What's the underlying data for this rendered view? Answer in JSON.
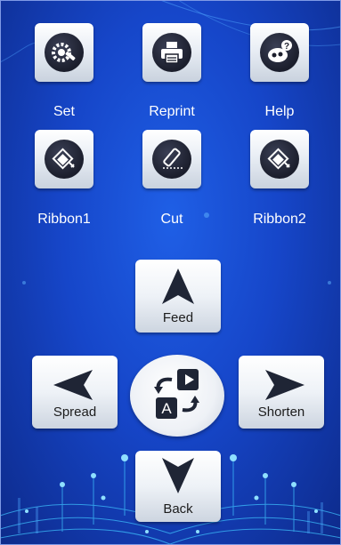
{
  "app": {
    "colors": {
      "bg": "#1646c9",
      "accent": "#3fa9ff",
      "tile": "#e9eef5",
      "icon_dark": "#1b1e2c"
    }
  },
  "grid": {
    "items": [
      {
        "label": "Set",
        "icon": "gear-wrench-icon"
      },
      {
        "label": "Reprint",
        "icon": "printer-icon"
      },
      {
        "label": "Help",
        "icon": "help-icon"
      },
      {
        "label": "Ribbon1",
        "icon": "ribbon-icon"
      },
      {
        "label": "Cut",
        "icon": "cutter-icon"
      },
      {
        "label": "Ribbon2",
        "icon": "ribbon-icon"
      }
    ]
  },
  "controls": {
    "feed": "Feed",
    "spread": "Spread",
    "shorten": "Shorten",
    "back": "Back",
    "center_letter": "A"
  }
}
